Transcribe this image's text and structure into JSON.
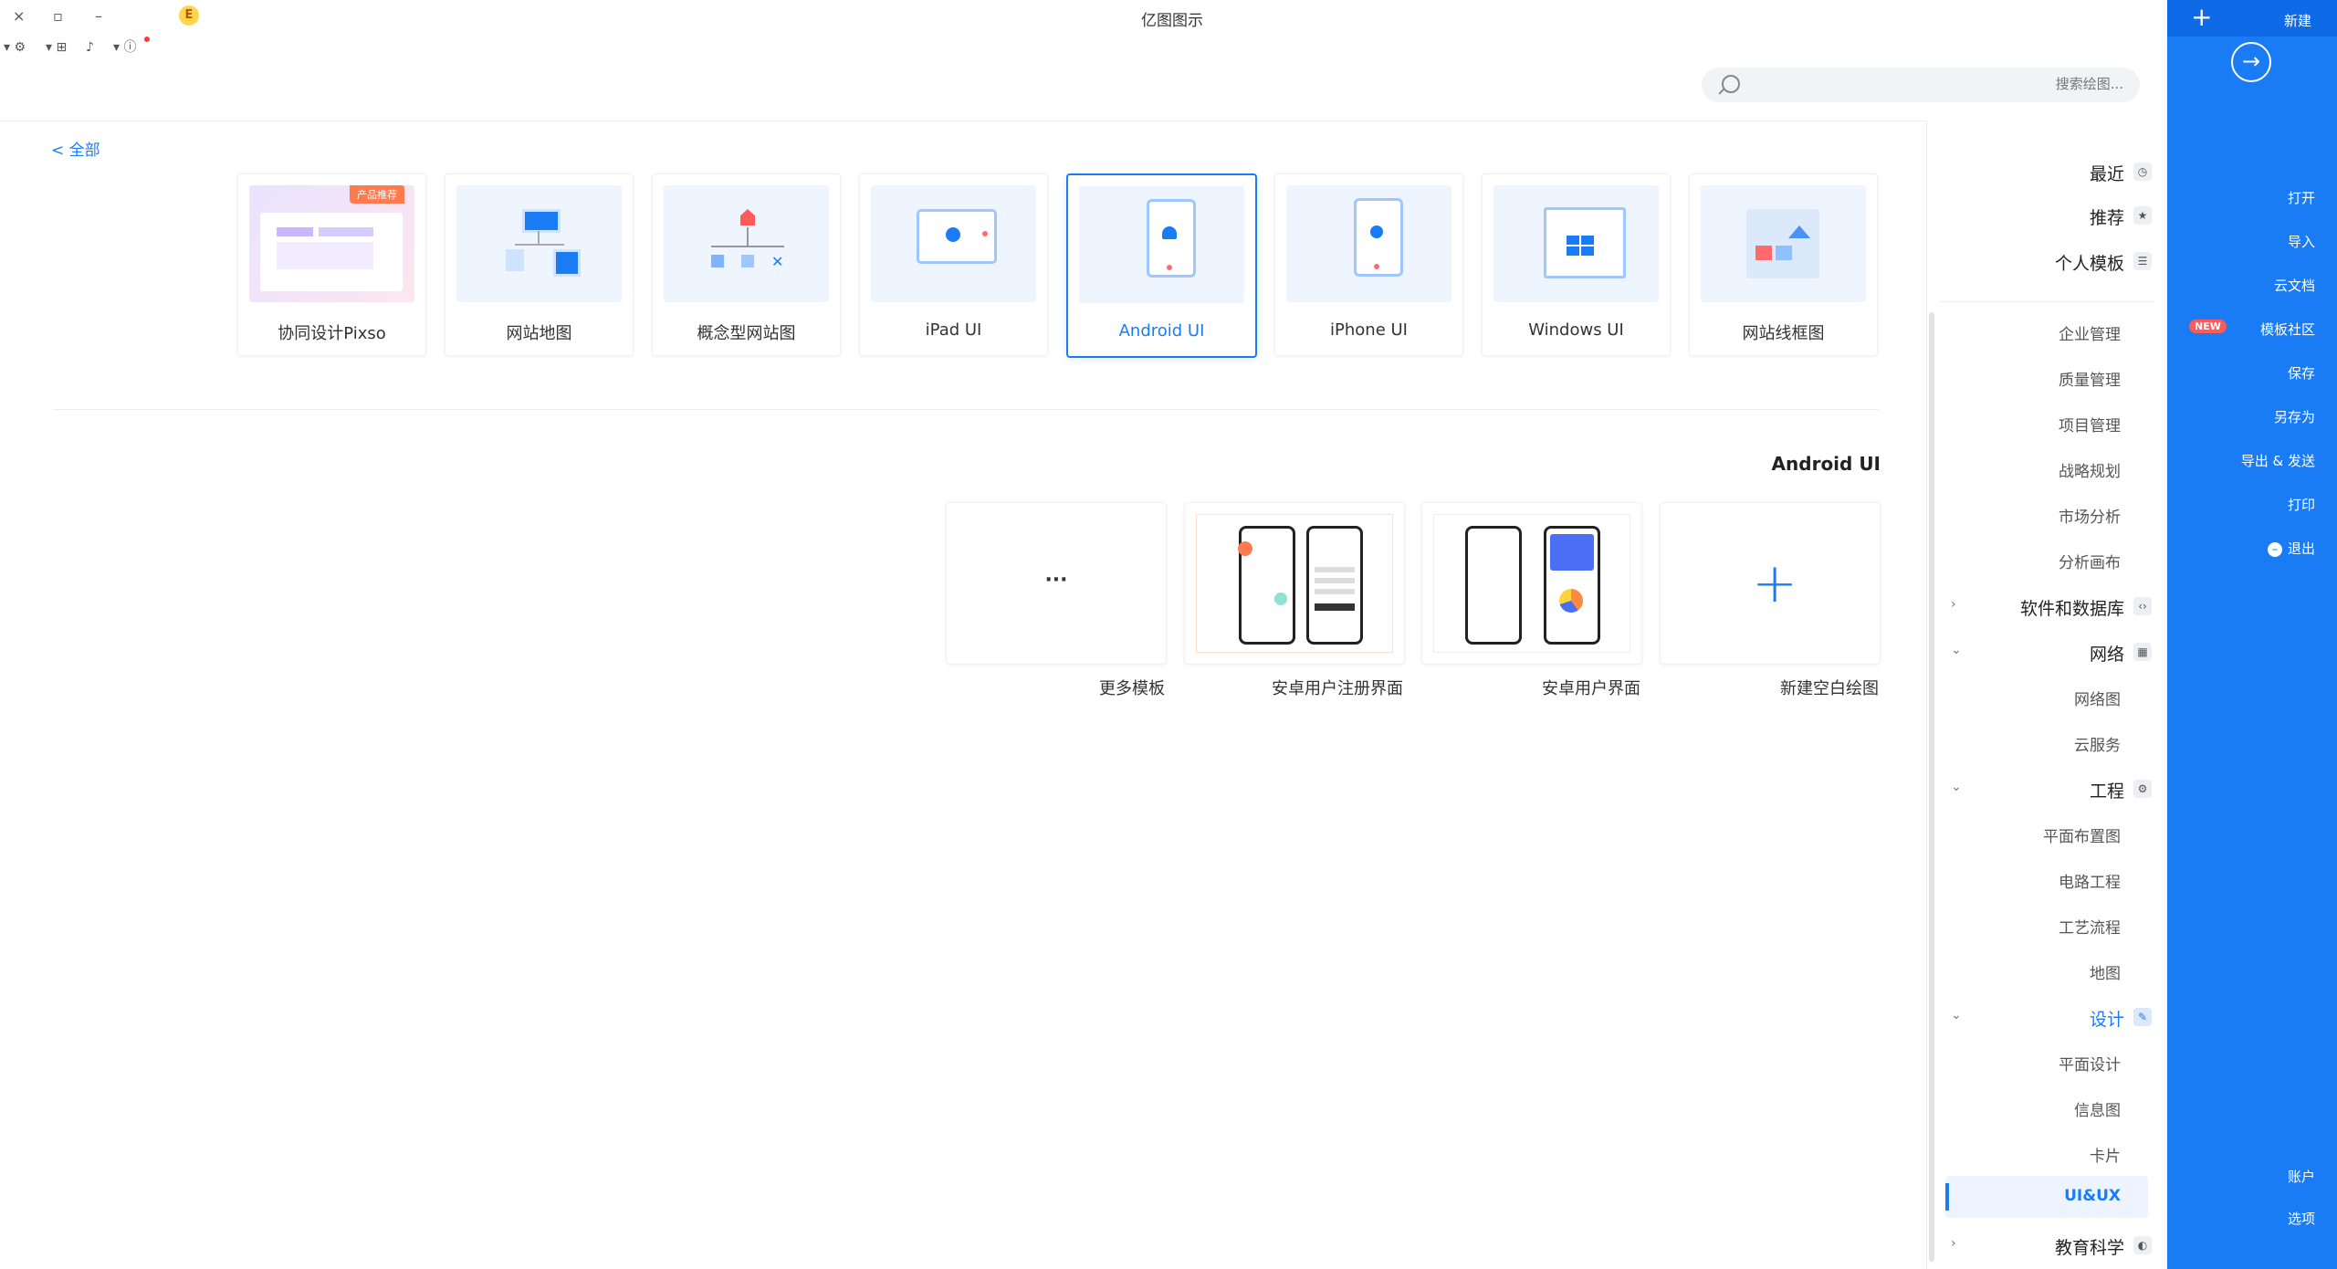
{
  "window": {
    "title": "亿图图示",
    "controls": {
      "close": "×",
      "restore": "▫",
      "minimize": "–"
    }
  },
  "search": {
    "placeholder": "搜索绘图..."
  },
  "back_link": "< 全部",
  "templates": [
    {
      "label": "网站线框图",
      "icon": "wireframe-icon"
    },
    {
      "label": "Windows UI",
      "icon": "windows-icon"
    },
    {
      "label": "iPhone UI",
      "icon": "apple-icon"
    },
    {
      "label": "Android UI",
      "icon": "android-icon",
      "selected": true
    },
    {
      "label": "iPad UI",
      "icon": "ipad-icon"
    },
    {
      "label": "概念型网站图",
      "icon": "concept-site-icon"
    },
    {
      "label": "网站地图",
      "icon": "sitemap-icon"
    },
    {
      "label": "协同设计Pixso",
      "icon": "pixso-icon",
      "badge": "产品推荐"
    }
  ],
  "section_title": "Android UI",
  "examples": [
    {
      "label": "新建空白绘图"
    },
    {
      "label": "安卓用户界面"
    },
    {
      "label": "安卓用户注册界面"
    },
    {
      "label": "更多模板",
      "more": "···"
    }
  ],
  "nav": {
    "top_items": [
      {
        "label": "最近",
        "icon": "clock-icon"
      },
      {
        "label": "推荐",
        "icon": "star-icon"
      },
      {
        "label": "个人模板",
        "icon": "template-icon"
      }
    ],
    "subs_business": [
      "企业管理",
      "质量管理",
      "项目管理",
      "战略规划",
      "市场分析",
      "分析画布"
    ],
    "group_software": "软件和数据库",
    "group_network": "网络",
    "subs_network": [
      "网络图",
      "云服务"
    ],
    "group_engineering": "工程",
    "subs_engineering": [
      "平面布置图",
      "电路工程",
      "工艺流程",
      "地图"
    ],
    "group_design": "设计",
    "subs_design": [
      "平面设计",
      "信息图",
      "卡片",
      "UI&UX"
    ],
    "group_education": "教育科学"
  },
  "sidebar": {
    "items": [
      "新建",
      "打开",
      "导入",
      "云文档",
      "模板社区",
      "保存",
      "另存为",
      "导出 & 发送",
      "打印",
      "退出"
    ],
    "bottom": [
      "账户",
      "选项"
    ],
    "new_badge": "NEW"
  },
  "colors": {
    "accent": "#1a7cf4",
    "sidebar_bg": "#1a7cf4",
    "badge_red": "#ff5a5a",
    "pixso_badge": "#ff7a4f"
  }
}
